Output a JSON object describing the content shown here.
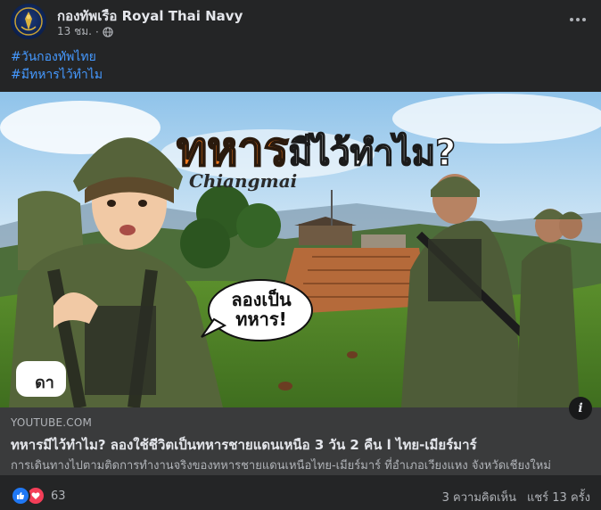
{
  "post": {
    "page_name": "กองทัพเรือ Royal Thai Navy",
    "time": "13 ชม.",
    "separator": "·",
    "hashtags": [
      "#วันกองทัพไทย",
      "#มีทหารไว้ทำไม"
    ]
  },
  "thumbnail": {
    "headline_main": "ทหาร",
    "headline_rest": "มีไว้ทำไม?",
    "location": "Chiangmai",
    "bubble_line1": "ลองเป็น",
    "bubble_line2": "ทหาร!",
    "logo_text": "ดา"
  },
  "link": {
    "domain": "YOUTUBE.COM",
    "title": "ทหารมีไว้ทำไม? ลองใช้ชีวิตเป็นทหารชายแดนเหนือ 3 วัน 2 คืน l ไทย-เมียร์มาร์",
    "description": "การเดินทางไปตามติดการทำงานจริงของทหารชายแดนเหนือไทย-เมียร์มาร์ ที่อำเภอเวียงแหง จังหวัดเชียงใหม่",
    "info_label": "i"
  },
  "footer": {
    "reaction_count": "63",
    "comments": "3 ความคิดเห็น",
    "shares": "แชร์ 13 ครั้ง"
  },
  "colors": {
    "background": "#242526",
    "hashtag": "#4599ff",
    "headline_orange": "#f47b20",
    "like_blue": "#2078f4",
    "love_red": "#f33e58"
  }
}
